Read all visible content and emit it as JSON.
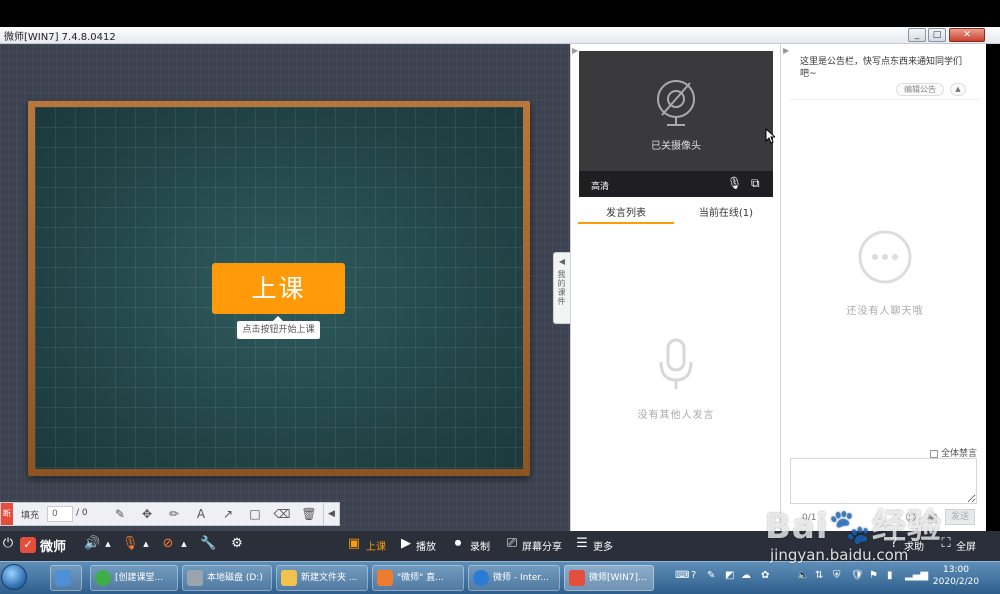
{
  "window": {
    "title": "微师[WIN7] 7.4.8.0412",
    "min": "_",
    "max": "□",
    "close": "✕"
  },
  "board": {
    "start_button": "上课",
    "start_tip": "点击按钮开始上课"
  },
  "drawbar": {
    "tag": "断",
    "fill_label": "填充",
    "page_value": "0",
    "page_total": "/ 0",
    "collapse": "◀"
  },
  "sidetab": {
    "arrow": "◀",
    "label": "我的课件"
  },
  "camera": {
    "status": "已关摄像头",
    "quality": "高清"
  },
  "mid_tabs": [
    {
      "label": "发言列表"
    },
    {
      "label": "当前在线(1)"
    }
  ],
  "speak_empty": "没有其他人发言",
  "notice": {
    "text": "这里是公告栏，快写点东西来通知同学们吧~",
    "edit": "编辑公告",
    "collapse": "▲"
  },
  "chat_empty": "还没有人聊天哦",
  "chat": {
    "mute_all": "全体禁言",
    "counter": "0/1",
    "send": "发送"
  },
  "appbar": {
    "brand": "微师",
    "brand_icon": "✓",
    "class": "上课",
    "play": "播放",
    "record": "录制",
    "share": "屏幕分享",
    "more": "更多",
    "help": "求助",
    "fullscreen": "全屏"
  },
  "taskbar": {
    "tasks": [
      {
        "label": "[创建课堂..."
      },
      {
        "label": "本地磁盘 (D:)"
      },
      {
        "label": "新建文件夹 ..."
      },
      {
        "label": "\"微师\" 直..."
      },
      {
        "label": "微师 - Inter..."
      },
      {
        "label": "微师[WIN7]..."
      }
    ],
    "time": "13:00",
    "date": "2020/2/20"
  },
  "watermark": {
    "big": "Bai🐾经验",
    "small": "jingyan.baidu.com"
  },
  "colors": {
    "accent": "#ff9b0a",
    "brand_red": "#e54d3c",
    "board": "#234649",
    "appbar": "#2a2f3a"
  }
}
